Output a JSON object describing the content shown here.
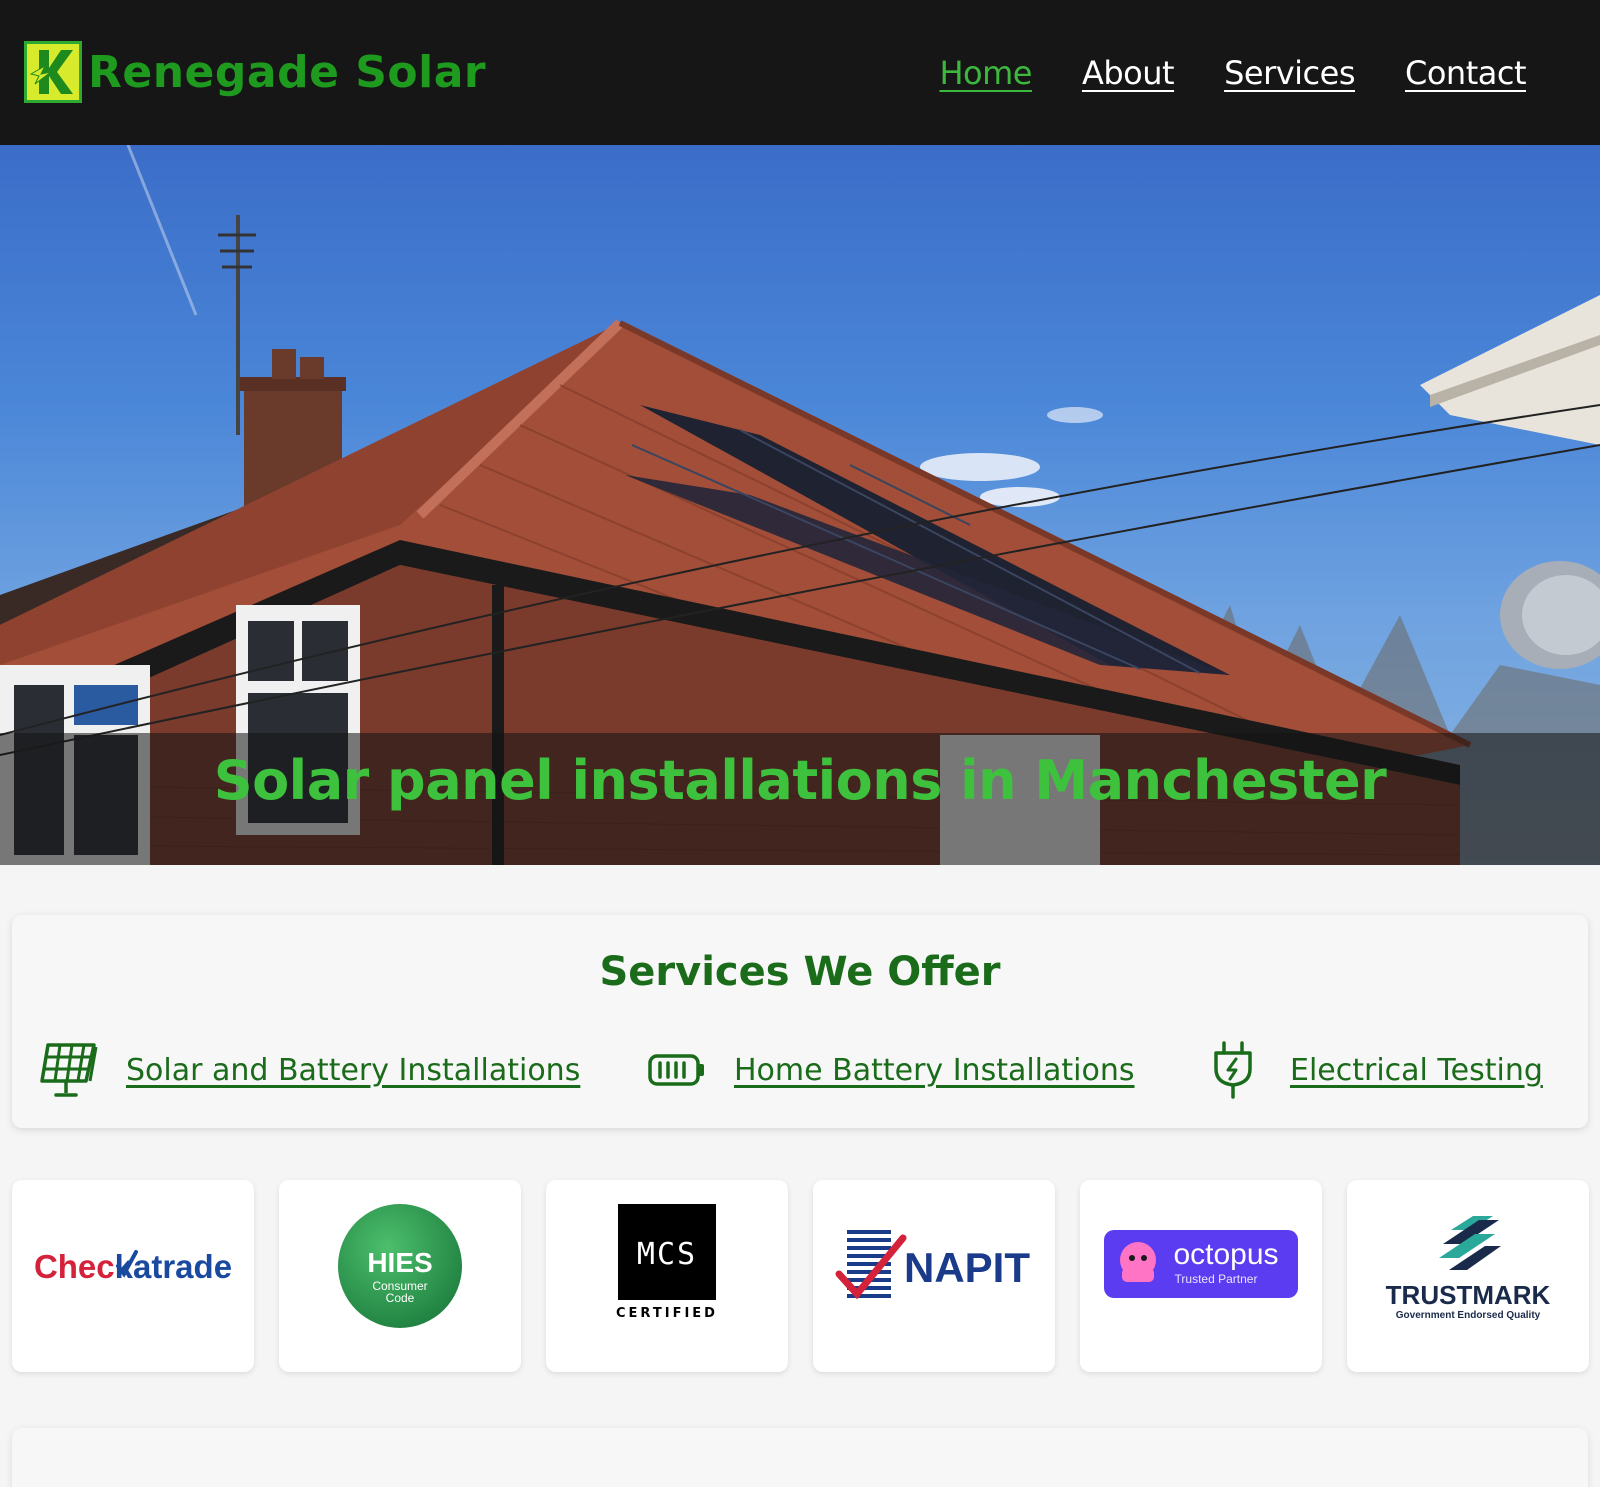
{
  "header": {
    "brand": "Renegade Solar",
    "nav": [
      {
        "label": "Home",
        "active": true
      },
      {
        "label": "About",
        "active": false
      },
      {
        "label": "Services",
        "active": false
      },
      {
        "label": "Contact",
        "active": false
      }
    ]
  },
  "hero": {
    "title": "Solar panel installations in Manchester"
  },
  "services": {
    "heading": "Services We Offer",
    "items": [
      {
        "label": "Solar and Battery Installations",
        "icon": "solar-panel-icon"
      },
      {
        "label": "Home Battery Installations",
        "icon": "battery-icon"
      },
      {
        "label": "Electrical Testing",
        "icon": "plug-icon"
      }
    ]
  },
  "accreditations": [
    {
      "name": "Checkatrade",
      "text": "Checkatrade",
      "color": "#d4223a"
    },
    {
      "name": "HIES",
      "text": "HIES",
      "subtext": "Consumer Code",
      "color": "#2a9a4a"
    },
    {
      "name": "MCS",
      "text": "MCS",
      "subtext": "CERTIFIED",
      "color": "#000000"
    },
    {
      "name": "NAPIT",
      "text": "NAPIT",
      "color": "#1a3a8a"
    },
    {
      "name": "octopus",
      "text": "octopus",
      "subtext": "Trusted Partner",
      "color": "#5b3cf0"
    },
    {
      "name": "TrustMark",
      "text": "TRUSTMARK",
      "subtext": "Government Endorsed Quality",
      "color": "#1a2a4a"
    }
  ],
  "colors": {
    "accent": "#3cb83c",
    "dark_green": "#1a6b1a",
    "header_bg": "#161616"
  }
}
